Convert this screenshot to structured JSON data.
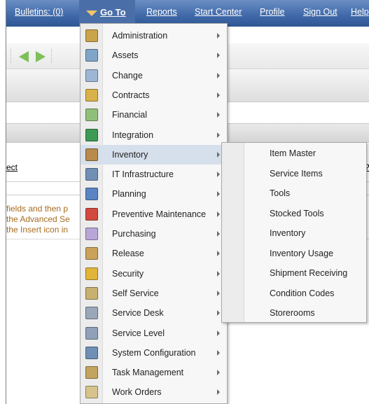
{
  "top_nav": {
    "bulletins": "Bulletins: (0)",
    "goto": "Go To",
    "reports": "Reports",
    "start_center": "Start Center",
    "profile": "Profile",
    "sign_out": "Sign Out",
    "help": "Help"
  },
  "background": {
    "column_header_left": "ect",
    "column_header_right": "?",
    "hint_lines": [
      "fields and then p",
      "the Advanced Se",
      "the Insert icon in"
    ]
  },
  "goto_menu": {
    "items": [
      {
        "label": "Administration",
        "icon": "administration-icon",
        "color": "#c9a44a"
      },
      {
        "label": "Assets",
        "icon": "assets-icon",
        "color": "#7fa6c9"
      },
      {
        "label": "Change",
        "icon": "change-icon",
        "color": "#9db6d6"
      },
      {
        "label": "Contracts",
        "icon": "contracts-icon",
        "color": "#d9b24a"
      },
      {
        "label": "Financial",
        "icon": "financial-icon",
        "color": "#8fc07a"
      },
      {
        "label": "Integration",
        "icon": "integration-icon",
        "color": "#3c9a54"
      },
      {
        "label": "Inventory",
        "icon": "inventory-icon",
        "color": "#b88a4c"
      },
      {
        "label": "IT Infrastructure",
        "icon": "it-infrastructure-icon",
        "color": "#6f8fb5"
      },
      {
        "label": "Planning",
        "icon": "planning-icon",
        "color": "#5a84c2"
      },
      {
        "label": "Preventive Maintenance",
        "icon": "preventive-maintenance-icon",
        "color": "#d24a3f"
      },
      {
        "label": "Purchasing",
        "icon": "purchasing-icon",
        "color": "#b8a6d8"
      },
      {
        "label": "Release",
        "icon": "release-icon",
        "color": "#c9a35a"
      },
      {
        "label": "Security",
        "icon": "security-icon",
        "color": "#e0b53a"
      },
      {
        "label": "Self Service",
        "icon": "self-service-icon",
        "color": "#c7b070"
      },
      {
        "label": "Service Desk",
        "icon": "service-desk-icon",
        "color": "#9aa7b8"
      },
      {
        "label": "Service Level",
        "icon": "service-level-icon",
        "color": "#8fa0b8"
      },
      {
        "label": "System Configuration",
        "icon": "system-configuration-icon",
        "color": "#6f8fb5"
      },
      {
        "label": "Task Management",
        "icon": "task-management-icon",
        "color": "#c2a45e"
      },
      {
        "label": "Work Orders",
        "icon": "work-orders-icon",
        "color": "#d7c48c"
      }
    ]
  },
  "inventory_submenu": {
    "items": [
      "Item Master",
      "Service Items",
      "Tools",
      "Stocked Tools",
      "Inventory",
      "Inventory Usage",
      "Shipment Receiving",
      "Condition Codes",
      "Storerooms"
    ]
  },
  "colors": {
    "nav_bar": "#3f68a8",
    "menu_highlight": "#d6e0ec",
    "hint_text": "#a66b1f"
  }
}
